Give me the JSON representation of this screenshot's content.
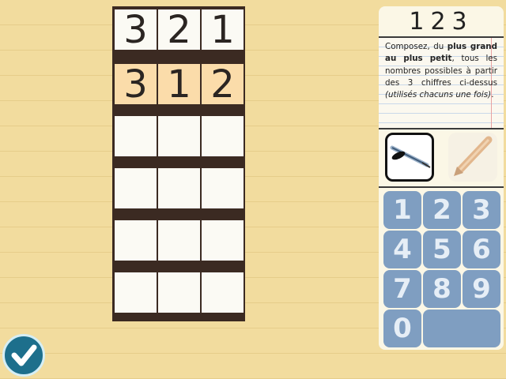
{
  "board": {
    "rows": [
      [
        "3",
        "2",
        "1"
      ],
      [
        "3",
        "1",
        "2"
      ],
      [
        "",
        "",
        ""
      ],
      [
        "",
        "",
        ""
      ],
      [
        "",
        "",
        ""
      ],
      [
        "",
        "",
        ""
      ]
    ],
    "highlighted_row": 1
  },
  "panel": {
    "digits": "123",
    "instructions": {
      "t1": "Composez, du ",
      "b1": "plus grand au plus petit",
      "t2": ", tous les nombres possibles à partir des 3 chiffres ci-dessus ",
      "i1": "(utilisés chacuns une fois)",
      "t3": "."
    }
  },
  "tools": {
    "pen": "pen-icon",
    "pencil": "pencil-icon",
    "selected": "pen"
  },
  "keypad": {
    "keys": [
      "1",
      "2",
      "3",
      "4",
      "5",
      "6",
      "7",
      "8",
      "9",
      "0"
    ]
  },
  "validate": {
    "icon": "checkmark-icon"
  },
  "colors": {
    "background": "#f2dc9e",
    "board": "#3b2a22",
    "cell": "#fbfaf4",
    "cell_highlight": "#fbdcaa",
    "key": "#7f9ec1",
    "validate": "#1d6f8c"
  }
}
